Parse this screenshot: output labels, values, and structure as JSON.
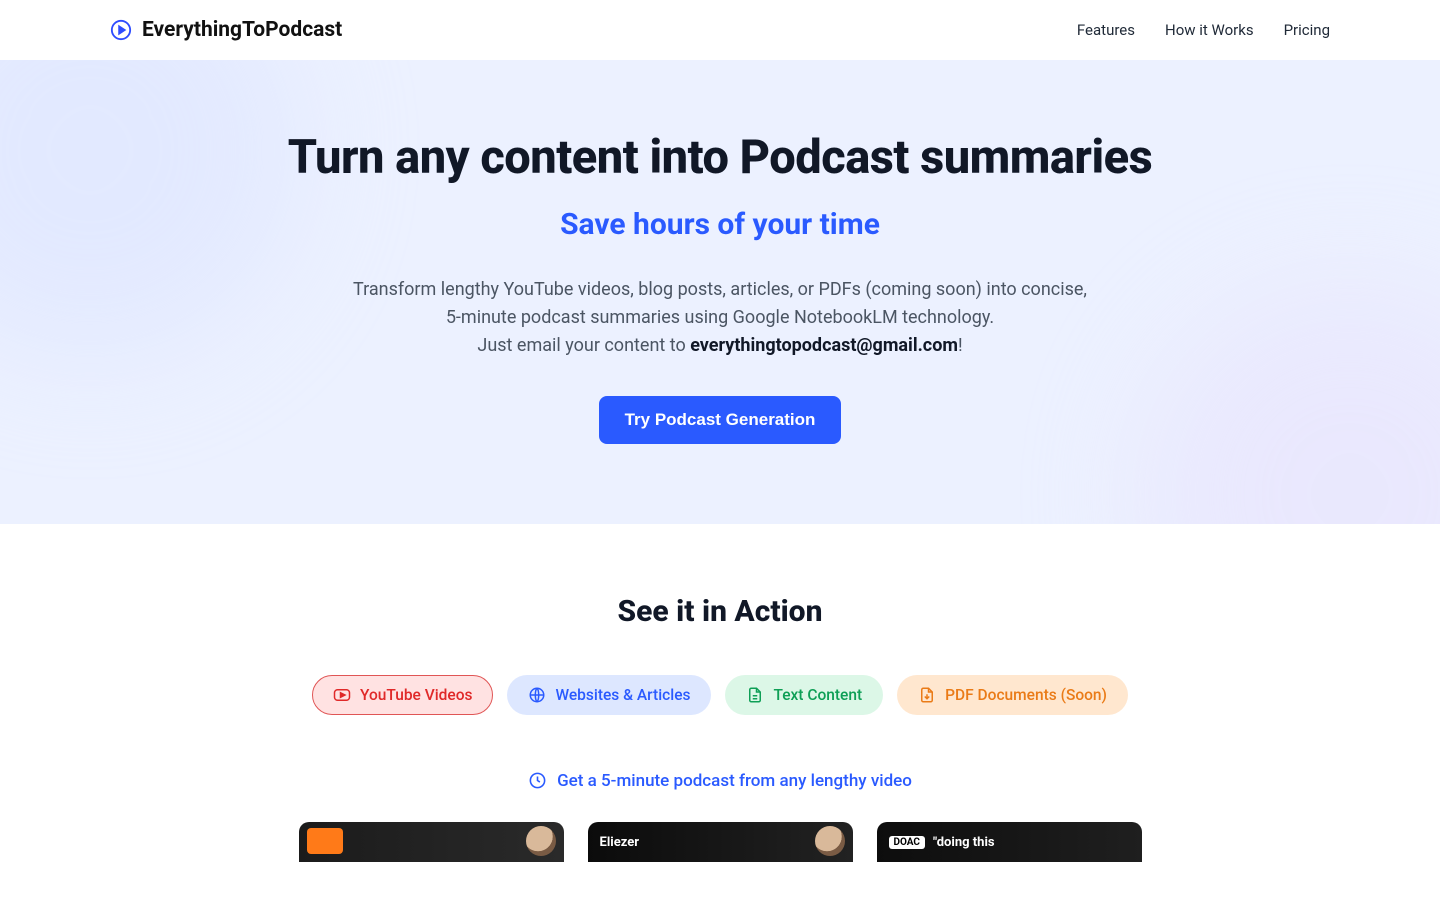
{
  "brand": "EverythingToPodcast",
  "nav": {
    "features": "Features",
    "how": "How it Works",
    "pricing": "Pricing"
  },
  "hero": {
    "title": "Turn any content into Podcast summaries",
    "subtitle": "Save hours of your time",
    "desc_line1": "Transform lengthy YouTube videos, blog posts, articles, or PDFs (coming soon) into concise, 5-minute podcast summaries using Google NotebookLM technology.",
    "desc_line2_prefix": "Just email your content to ",
    "desc_email": "everythingtopodcast@gmail.com",
    "desc_line2_suffix": "!",
    "cta": "Try Podcast Generation"
  },
  "action": {
    "title": "See it in Action",
    "pills": {
      "youtube": "YouTube Videos",
      "web": "Websites & Articles",
      "text": "Text Content",
      "pdf": "PDF Documents (Soon)"
    },
    "tagline": "Get a 5-minute podcast from any lengthy video"
  },
  "thumbs": {
    "b": "Eliezer",
    "c_tag": "DOAC",
    "c_text": "\"doing this"
  }
}
